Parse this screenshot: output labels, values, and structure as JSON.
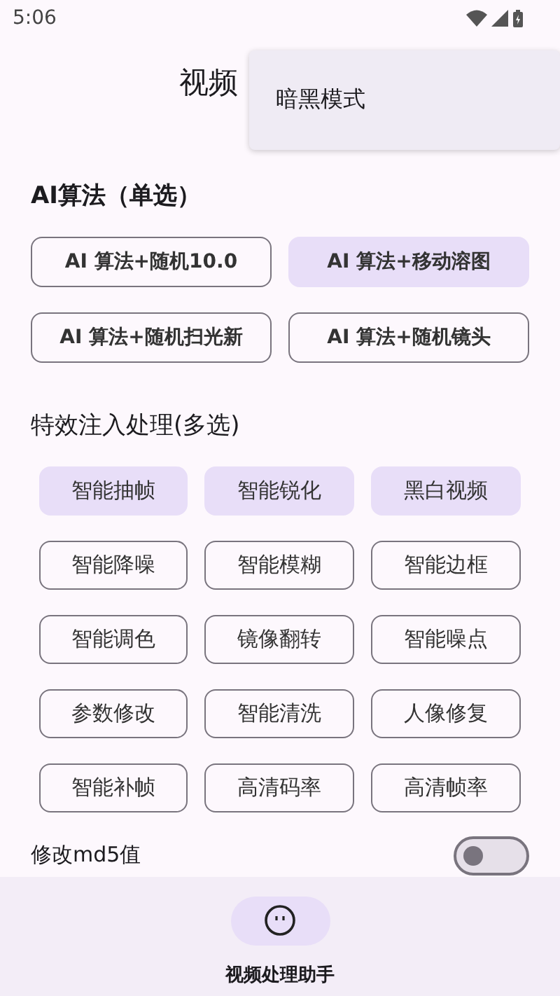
{
  "status_bar": {
    "time": "5:06"
  },
  "app_bar": {
    "title": "视频"
  },
  "menu": {
    "items": [
      "暗黑模式"
    ]
  },
  "algorithm": {
    "title": "AI算法（单选）",
    "options": [
      {
        "label": "AI 算法+随机10.0",
        "selected": false
      },
      {
        "label": "AI 算法+移动溶图",
        "selected": true
      },
      {
        "label": "AI 算法+随机扫光新",
        "selected": false
      },
      {
        "label": "AI 算法+随机镜头",
        "selected": false
      }
    ]
  },
  "effects": {
    "title": "特效注入处理(多选)",
    "options": [
      {
        "label": "智能抽帧",
        "selected": true
      },
      {
        "label": "智能锐化",
        "selected": true
      },
      {
        "label": "黑白视频",
        "selected": true
      },
      {
        "label": "智能降噪",
        "selected": false
      },
      {
        "label": "智能模糊",
        "selected": false
      },
      {
        "label": "智能边框",
        "selected": false
      },
      {
        "label": "智能调色",
        "selected": false
      },
      {
        "label": "镜像翻转",
        "selected": false
      },
      {
        "label": "智能噪点",
        "selected": false
      },
      {
        "label": "参数修改",
        "selected": false
      },
      {
        "label": "智能清洗",
        "selected": false
      },
      {
        "label": "人像修复",
        "selected": false
      },
      {
        "label": "智能补帧",
        "selected": false
      },
      {
        "label": "高清码率",
        "selected": false
      },
      {
        "label": "高清帧率",
        "selected": false
      }
    ]
  },
  "md5_toggle": {
    "label": "修改md5值",
    "on": false
  },
  "bottom_nav": {
    "items": [
      {
        "label": "视频处理助手",
        "selected": true
      }
    ]
  }
}
